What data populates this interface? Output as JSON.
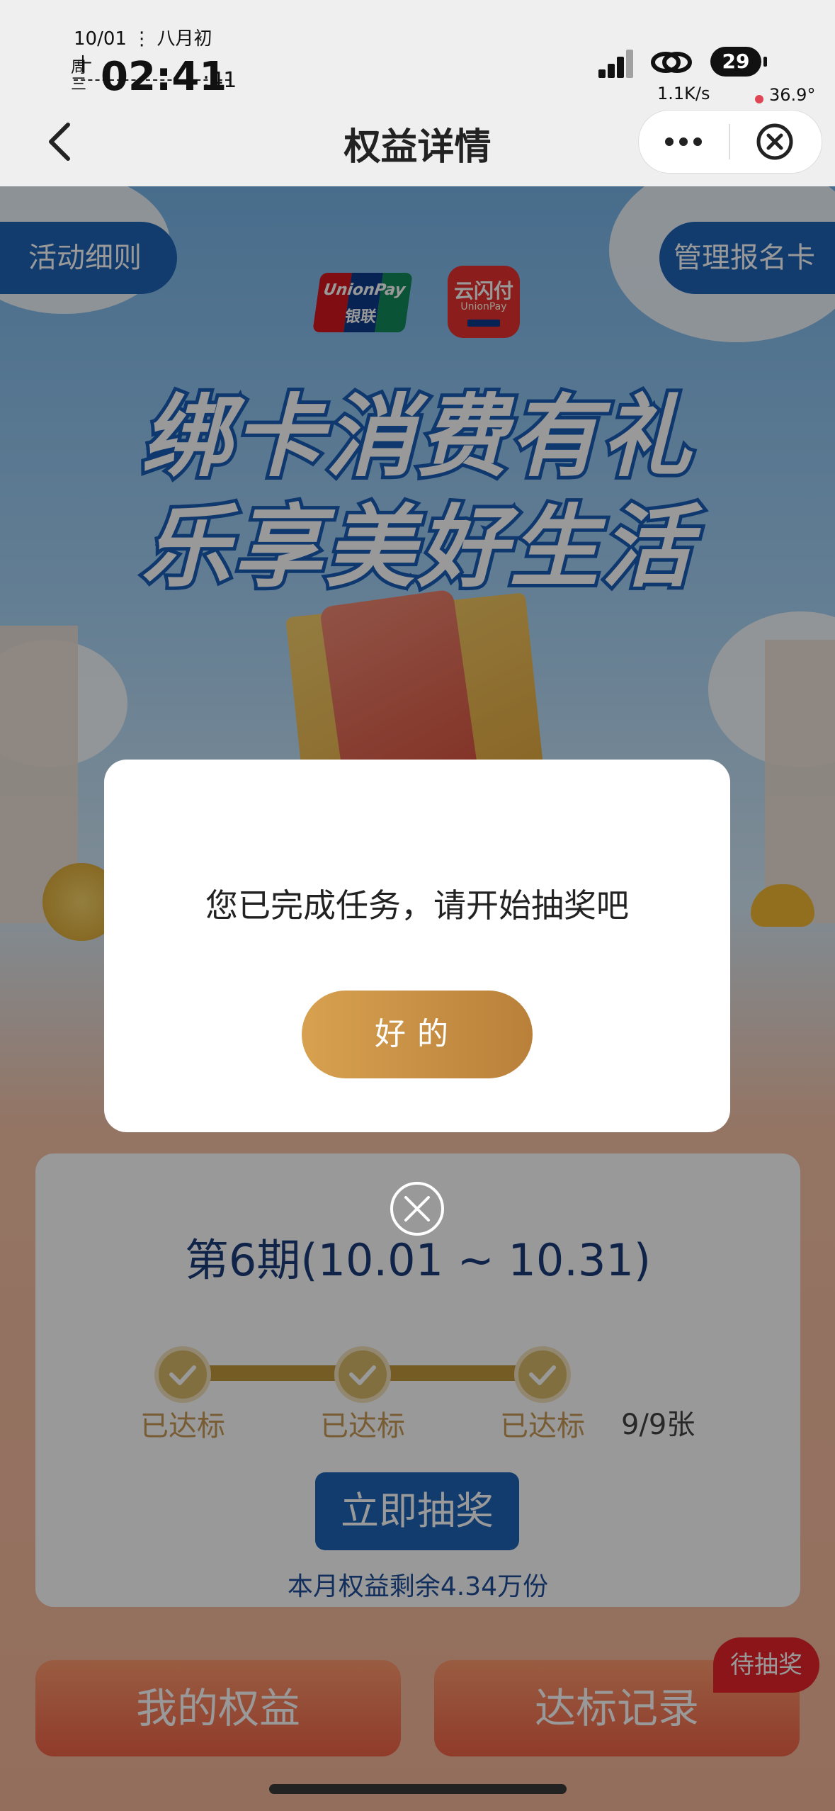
{
  "status_bar": {
    "date_lunar": "10/01 ⋮ 八月初十",
    "weekday": "周三",
    "time_main": "02:41",
    "time_seconds": ":41",
    "battery": "29",
    "net_speed": "1.1K/s",
    "temperature": "36.9°"
  },
  "nav": {
    "title": "权益详情"
  },
  "banner": {
    "rules_label": "活动细则",
    "manage_label": "管理报名卡",
    "logo_unionpay_en": "UnionPay",
    "logo_unionpay_cn": "银联",
    "logo_yunshanfu_cn": "云闪付",
    "logo_yunshanfu_en": "UnionPay",
    "slogan_line1": "绑卡消费有礼",
    "slogan_line2": "乐享美好生活"
  },
  "period": {
    "title": "第6期(10.01 ~ 10.31)",
    "steps": [
      "已达标",
      "已达标",
      "已达标"
    ],
    "count": "9/9张",
    "draw_button": "立即抽奖",
    "remaining": "本月权益剩余4.34万份"
  },
  "bottom": {
    "my_benefits": "我的权益",
    "records": "达标记录",
    "badge": "待抽奖"
  },
  "modal": {
    "message": "您已完成任务，请开始抽奖吧",
    "ok_button": "好的"
  },
  "colors": {
    "brand_blue": "#1e64b8",
    "gold": "#c49a3f",
    "orange": "#f16447",
    "badge_red": "#e8242a"
  }
}
